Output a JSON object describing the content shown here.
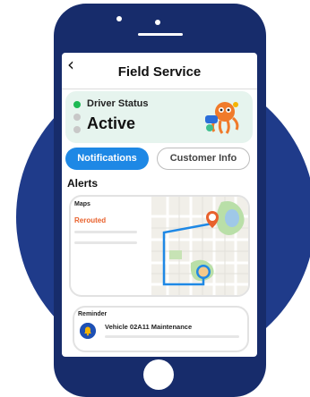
{
  "header": {
    "title": "Field Service"
  },
  "driver_status": {
    "label": "Driver Status",
    "value": "Active"
  },
  "tabs": [
    {
      "label": "Notifications",
      "active": true
    },
    {
      "label": "Customer Info",
      "active": false
    }
  ],
  "alerts": {
    "heading": "Alerts",
    "map_card": {
      "label": "Maps",
      "status": "Rerouted"
    },
    "reminder_card": {
      "label": "Reminder",
      "title": "Vehicle 02A11 Maintenance"
    }
  },
  "colors": {
    "accent": "#1e88e5",
    "status_green": "#1db954",
    "rerouted": "#e8612c",
    "phone_body": "#172c6b",
    "backdrop_circle": "#1f3b8a"
  },
  "icons": [
    "back-chevron-icon",
    "octopus-mascot-icon",
    "map-pin-icon",
    "bell-icon"
  ]
}
